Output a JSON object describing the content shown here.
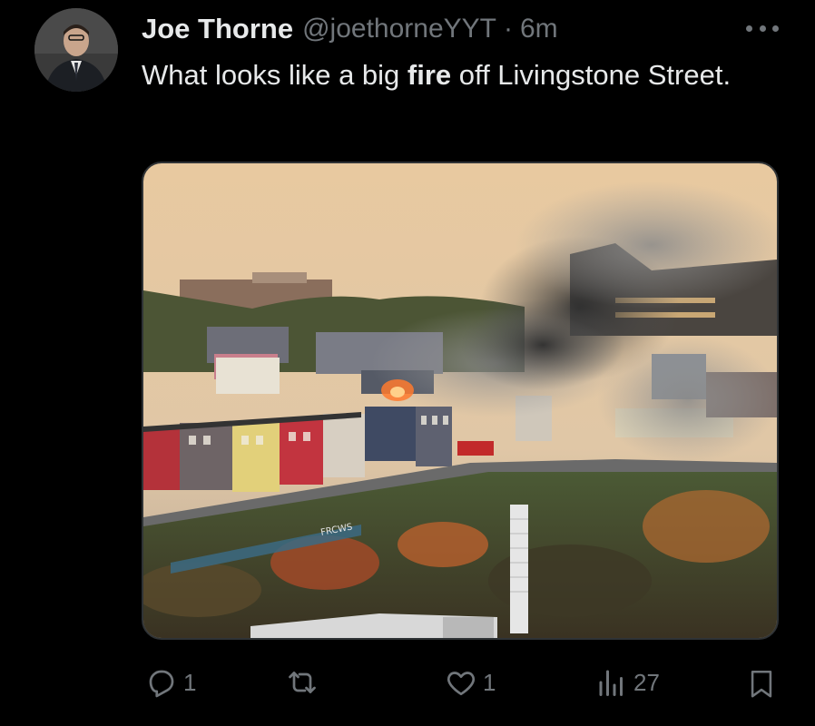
{
  "author": {
    "name": "Joe Thorne",
    "handle": "@joethorneYYT",
    "separator": "·",
    "time": "6m",
    "avatar_icon": "profile-photo"
  },
  "tweet": {
    "text_before": "What looks like a big ",
    "text_bold": "fire",
    "text_after": " off Livingstone Street."
  },
  "media": {
    "description_icon": "photo-fire-smoke-over-houses",
    "graffiti_text": "FRCWS"
  },
  "actions": {
    "reply": {
      "icon": "reply-icon",
      "count": "1"
    },
    "retweet": {
      "icon": "retweet-icon",
      "count": ""
    },
    "like": {
      "icon": "heart-icon",
      "count": "1"
    },
    "views": {
      "icon": "views-icon",
      "count": "27"
    },
    "bookmark": {
      "icon": "bookmark-icon"
    }
  },
  "colors": {
    "background": "#000000",
    "text": "#e7e9ea",
    "muted": "#71767b"
  }
}
